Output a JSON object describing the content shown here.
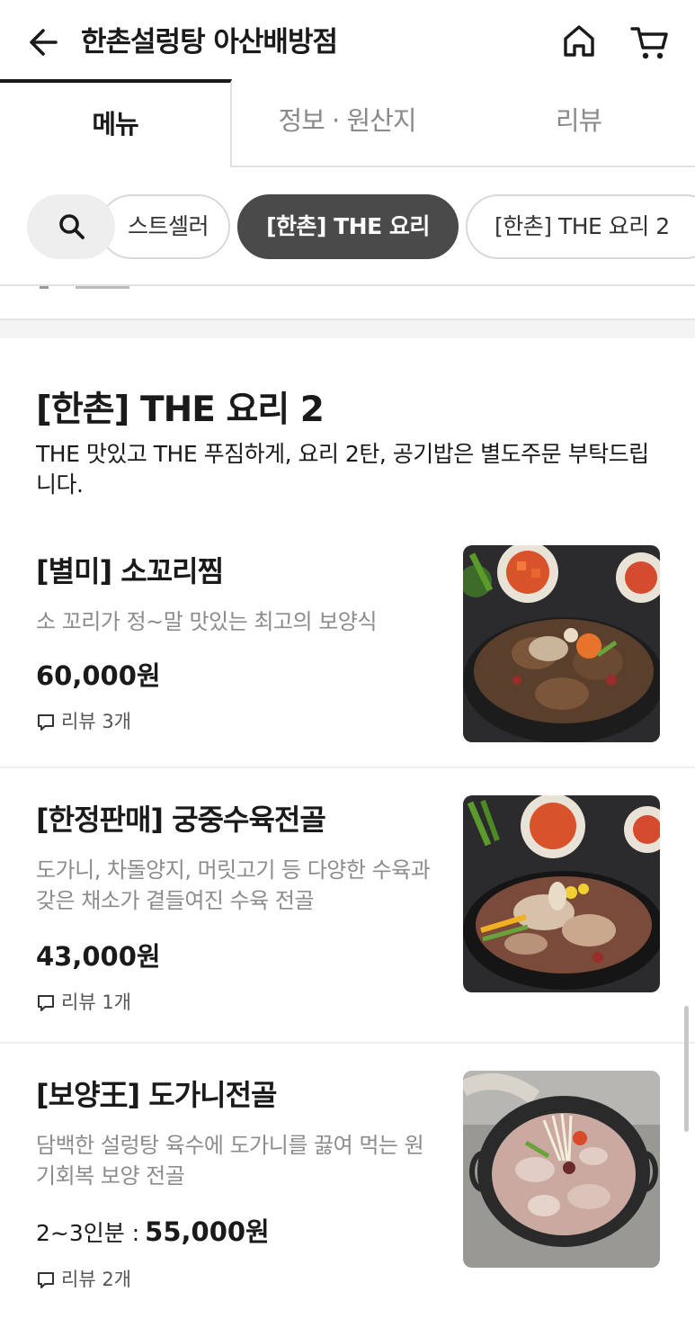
{
  "header": {
    "title": "한촌설렁탕 아산배방점"
  },
  "tabs": [
    {
      "label": "메뉴",
      "active": true
    },
    {
      "label": "정보 · 원산지",
      "active": false
    },
    {
      "label": "리뷰",
      "active": false
    }
  ],
  "chips": [
    {
      "label": "스트셀러",
      "active": false
    },
    {
      "label": "[한촌] THE 요리",
      "active": true
    },
    {
      "label": "[한촌] THE 요리 2",
      "active": false
    }
  ],
  "section": {
    "title": "[한촌] THE 요리 2",
    "description": "THE 맛있고 THE 푸짐하게, 요리 2탄, 공기밥은 별도주문 부탁드립니다."
  },
  "items": [
    {
      "name": "[별미] 소꼬리찜",
      "description": "소 꼬리가 정~말 맛있는 최고의 보양식",
      "portion": "",
      "price": "60,000원",
      "reviews": "리뷰 3개",
      "image": "braised-oxtail-photo"
    },
    {
      "name": "[한정판매] 궁중수육전골",
      "description": "도가니, 차돌양지, 머릿고기 등 다양한 수육과 갖은 채소가 곁들여진 수육 전골",
      "portion": "",
      "price": "43,000원",
      "reviews": "리뷰 1개",
      "image": "royal-suyuk-hotpot-photo"
    },
    {
      "name": "[보양王] 도가니전골",
      "description": "담백한 설렁탕 육수에 도가니를 끓여 먹는 원기회복 보양 전골",
      "portion": "2~3인분 :",
      "price": "55,000원",
      "reviews": "리뷰 2개",
      "image": "knee-cartilage-hotpot-photo"
    }
  ],
  "icons": {
    "back": "arrow-left-icon",
    "home": "home-icon",
    "cart": "cart-icon",
    "search": "search-icon",
    "review": "speech-bubble-icon"
  },
  "colors": {
    "text": "#1a1a1a",
    "muted": "#8c8c8c",
    "active_chip": "#4a4a4a",
    "divider": "#efefef"
  }
}
